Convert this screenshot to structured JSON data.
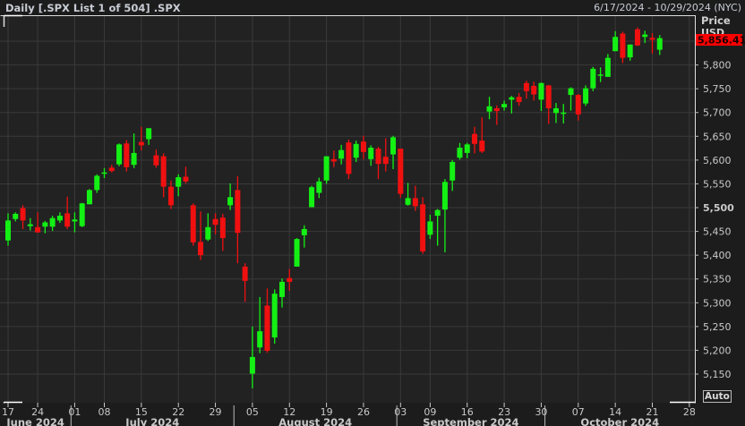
{
  "header": {
    "title": "Daily [.SPX List 1 of 504] .SPX",
    "date_range": "6/17/2024 - 10/29/2024 (NYC)"
  },
  "axis": {
    "price_label": "Price",
    "currency_label": "USD",
    "auto_button": "Auto"
  },
  "colors": {
    "up": "#14f014",
    "down": "#f01010",
    "background": "#222222",
    "grid": "#3a3a3a",
    "last_price_bg": "#ff0000"
  },
  "chart_data": {
    "type": "candlestick",
    "last_price": "5,856.41",
    "ylim": [
      5110,
      5900
    ],
    "y_ticks": [
      "5,150",
      "5,200",
      "5,250",
      "5,300",
      "5,350",
      "5,400",
      "5,450",
      "5,500",
      "5,550",
      "5,600",
      "5,650",
      "5,700",
      "5,750",
      "5,800",
      "5,850"
    ],
    "y_tick_values": [
      5150,
      5200,
      5250,
      5300,
      5350,
      5400,
      5450,
      5500,
      5550,
      5600,
      5650,
      5700,
      5750,
      5800,
      5850
    ],
    "x_ticks": [
      {
        "label": "17",
        "date": "2024-06-17"
      },
      {
        "label": "24",
        "date": "2024-06-24"
      },
      {
        "label": "01",
        "date": "2024-07-01"
      },
      {
        "label": "08",
        "date": "2024-07-08"
      },
      {
        "label": "15",
        "date": "2024-07-15"
      },
      {
        "label": "22",
        "date": "2024-07-22"
      },
      {
        "label": "29",
        "date": "2024-07-29"
      },
      {
        "label": "05",
        "date": "2024-08-05"
      },
      {
        "label": "12",
        "date": "2024-08-12"
      },
      {
        "label": "19",
        "date": "2024-08-19"
      },
      {
        "label": "26",
        "date": "2024-08-26"
      },
      {
        "label": "03",
        "date": "2024-09-03"
      },
      {
        "label": "09",
        "date": "2024-09-09"
      },
      {
        "label": "16",
        "date": "2024-09-16"
      },
      {
        "label": "23",
        "date": "2024-09-23"
      },
      {
        "label": "30",
        "date": "2024-09-30"
      },
      {
        "label": "07",
        "date": "2024-10-07"
      },
      {
        "label": "14",
        "date": "2024-10-14"
      },
      {
        "label": "21",
        "date": "2024-10-21"
      },
      {
        "label": "28",
        "date": "2024-10-28"
      }
    ],
    "months": [
      {
        "label": "June 2024",
        "prefix": "2024-06"
      },
      {
        "label": "July 2024",
        "prefix": "2024-07"
      },
      {
        "label": "August 2024",
        "prefix": "2024-08"
      },
      {
        "label": "September 2024",
        "prefix": "2024-09"
      },
      {
        "label": "October 2024",
        "prefix": "2024-10"
      }
    ],
    "columns": [
      "date",
      "open",
      "high",
      "low",
      "close"
    ],
    "candles": [
      [
        "2024-06-17",
        5431,
        5488,
        5420,
        5473
      ],
      [
        "2024-06-18",
        5476,
        5490,
        5471,
        5487
      ],
      [
        "2024-06-20",
        5499,
        5505,
        5455,
        5473
      ],
      [
        "2024-06-21",
        5461,
        5478,
        5452,
        5465
      ],
      [
        "2024-06-24",
        5459,
        5490,
        5447,
        5448
      ],
      [
        "2024-06-25",
        5460,
        5472,
        5446,
        5469
      ],
      [
        "2024-06-26",
        5460,
        5483,
        5451,
        5478
      ],
      [
        "2024-06-27",
        5473,
        5490,
        5468,
        5483
      ],
      [
        "2024-06-28",
        5488,
        5523,
        5455,
        5460
      ],
      [
        "2024-07-01",
        5471,
        5490,
        5448,
        5475
      ],
      [
        "2024-07-02",
        5461,
        5510,
        5459,
        5509
      ],
      [
        "2024-07-03",
        5507,
        5539,
        5507,
        5537
      ],
      [
        "2024-07-05",
        5537,
        5570,
        5531,
        5567
      ],
      [
        "2024-07-08",
        5572,
        5583,
        5562,
        5574
      ],
      [
        "2024-07-09",
        5584,
        5590,
        5574,
        5577
      ],
      [
        "2024-07-10",
        5591,
        5635,
        5587,
        5633
      ],
      [
        "2024-07-11",
        5635,
        5642,
        5576,
        5585
      ],
      [
        "2024-07-12",
        5590,
        5656,
        5583,
        5615
      ],
      [
        "2024-07-15",
        5638,
        5670,
        5620,
        5631
      ],
      [
        "2024-07-16",
        5644,
        5667,
        5632,
        5667
      ],
      [
        "2024-07-17",
        5610,
        5622,
        5584,
        5589
      ],
      [
        "2024-07-18",
        5608,
        5614,
        5522,
        5544
      ],
      [
        "2024-07-19",
        5544,
        5557,
        5497,
        5505
      ],
      [
        "2024-07-22",
        5544,
        5570,
        5524,
        5564
      ],
      [
        "2024-07-23",
        5565,
        5586,
        5551,
        5555
      ],
      [
        "2024-07-24",
        5505,
        5509,
        5420,
        5427
      ],
      [
        "2024-07-25",
        5428,
        5492,
        5390,
        5400
      ],
      [
        "2024-07-26",
        5433,
        5488,
        5430,
        5459
      ],
      [
        "2024-07-29",
        5476,
        5488,
        5444,
        5464
      ],
      [
        "2024-07-30",
        5479,
        5487,
        5409,
        5436
      ],
      [
        "2024-07-31",
        5505,
        5551,
        5495,
        5522
      ],
      [
        "2024-08-01",
        5537,
        5566,
        5383,
        5447
      ],
      [
        "2024-08-02",
        5376,
        5383,
        5302,
        5346
      ],
      [
        "2024-08-05",
        5151,
        5250,
        5120,
        5186
      ],
      [
        "2024-08-06",
        5206,
        5312,
        5194,
        5240
      ],
      [
        "2024-08-07",
        5294,
        5330,
        5195,
        5199
      ],
      [
        "2024-08-08",
        5227,
        5328,
        5214,
        5319
      ],
      [
        "2024-08-09",
        5312,
        5351,
        5290,
        5344
      ],
      [
        "2024-08-12",
        5352,
        5371,
        5325,
        5344
      ],
      [
        "2024-08-13",
        5376,
        5436,
        5376,
        5434
      ],
      [
        "2024-08-14",
        5442,
        5463,
        5416,
        5455
      ],
      [
        "2024-08-15",
        5501,
        5546,
        5501,
        5543
      ],
      [
        "2024-08-16",
        5531,
        5563,
        5520,
        5555
      ],
      [
        "2024-08-19",
        5557,
        5608,
        5550,
        5608
      ],
      [
        "2024-08-20",
        5602,
        5620,
        5585,
        5597
      ],
      [
        "2024-08-21",
        5603,
        5632,
        5591,
        5621
      ],
      [
        "2024-08-22",
        5637,
        5643,
        5560,
        5571
      ],
      [
        "2024-08-23",
        5605,
        5641,
        5596,
        5634
      ],
      [
        "2024-08-26",
        5639,
        5651,
        5602,
        5617
      ],
      [
        "2024-08-27",
        5602,
        5631,
        5588,
        5626
      ],
      [
        "2024-08-28",
        5624,
        5628,
        5560,
        5592
      ],
      [
        "2024-08-29",
        5607,
        5646,
        5576,
        5592
      ],
      [
        "2024-08-30",
        5612,
        5651,
        5581,
        5648
      ],
      [
        "2024-09-03",
        5624,
        5624,
        5521,
        5529
      ],
      [
        "2024-09-04",
        5506,
        5552,
        5504,
        5520
      ],
      [
        "2024-09-05",
        5520,
        5546,
        5493,
        5503
      ],
      [
        "2024-09-06",
        5507,
        5522,
        5403,
        5408
      ],
      [
        "2024-09-09",
        5443,
        5485,
        5434,
        5471
      ],
      [
        "2024-09-10",
        5483,
        5497,
        5420,
        5495
      ],
      [
        "2024-09-11",
        5496,
        5560,
        5406,
        5554
      ],
      [
        "2024-09-12",
        5557,
        5600,
        5535,
        5596
      ],
      [
        "2024-09-13",
        5605,
        5636,
        5601,
        5626
      ],
      [
        "2024-09-16",
        5615,
        5636,
        5604,
        5633
      ],
      [
        "2024-09-17",
        5655,
        5670,
        5614,
        5634
      ],
      [
        "2024-09-18",
        5641,
        5690,
        5615,
        5618
      ],
      [
        "2024-09-19",
        5702,
        5733,
        5686,
        5713
      ],
      [
        "2024-09-20",
        5709,
        5715,
        5674,
        5703
      ],
      [
        "2024-09-23",
        5711,
        5725,
        5704,
        5718
      ],
      [
        "2024-09-24",
        5727,
        5735,
        5698,
        5732
      ],
      [
        "2024-09-25",
        5733,
        5741,
        5714,
        5722
      ],
      [
        "2024-09-26",
        5762,
        5767,
        5729,
        5745
      ],
      [
        "2024-09-27",
        5756,
        5765,
        5725,
        5738
      ],
      [
        "2024-09-30",
        5727,
        5763,
        5703,
        5762
      ],
      [
        "2024-10-01",
        5757,
        5758,
        5676,
        5709
      ],
      [
        "2024-10-02",
        5699,
        5720,
        5678,
        5709
      ],
      [
        "2024-10-03",
        5698,
        5718,
        5677,
        5700
      ],
      [
        "2024-10-04",
        5737,
        5753,
        5704,
        5751
      ],
      [
        "2024-10-07",
        5737,
        5739,
        5683,
        5696
      ],
      [
        "2024-10-08",
        5719,
        5757,
        5714,
        5751
      ],
      [
        "2024-10-09",
        5751,
        5796,
        5745,
        5792
      ],
      [
        "2024-10-10",
        5778,
        5795,
        5764,
        5780
      ],
      [
        "2024-10-11",
        5775,
        5823,
        5775,
        5815
      ],
      [
        "2024-10-14",
        5829,
        5871,
        5829,
        5859
      ],
      [
        "2024-10-15",
        5866,
        5870,
        5804,
        5815
      ],
      [
        "2024-10-16",
        5816,
        5843,
        5809,
        5843
      ],
      [
        "2024-10-17",
        5875,
        5879,
        5840,
        5841
      ],
      [
        "2024-10-18",
        5859,
        5872,
        5846,
        5864
      ],
      [
        "2024-10-21",
        5857,
        5867,
        5824,
        5853
      ],
      [
        "2024-10-22",
        5832,
        5863,
        5821,
        5856.41
      ]
    ]
  }
}
